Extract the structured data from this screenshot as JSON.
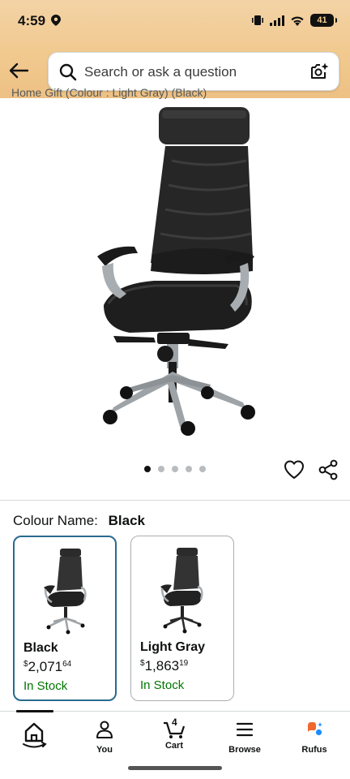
{
  "status_bar": {
    "time": "4:59",
    "battery": "41"
  },
  "search": {
    "placeholder": "Search or ask a question"
  },
  "breadcrumb": "Home Gift (Colour : Light Gray) (Black)",
  "gallery": {
    "image_count": 5,
    "active_index": 0
  },
  "variant_section": {
    "colour_label": "Colour Name:",
    "selected_colour": "Black",
    "options": [
      {
        "name": "Black",
        "currency": "$",
        "price_main": "2,071",
        "price_fraction": "64",
        "stock": "In Stock",
        "selected": true
      },
      {
        "name": "Light Gray",
        "currency": "$",
        "price_main": "1,863",
        "price_fraction": "19",
        "stock": "In Stock",
        "selected": false
      }
    ]
  },
  "bottom_nav": {
    "cart_count": "4",
    "items": [
      {
        "label": "",
        "icon": "home-icon"
      },
      {
        "label": "You",
        "icon": "person-icon"
      },
      {
        "label": "Cart",
        "icon": "cart-icon"
      },
      {
        "label": "Browse",
        "icon": "menu-icon"
      },
      {
        "label": "Rufus",
        "icon": "rufus-icon"
      }
    ]
  },
  "colors": {
    "header_gradient": "#f1c98f",
    "selected_border": "#2a6a8f",
    "in_stock": "#007600",
    "rufus_orange": "#f0682d",
    "rufus_blue": "#1a8cff"
  }
}
